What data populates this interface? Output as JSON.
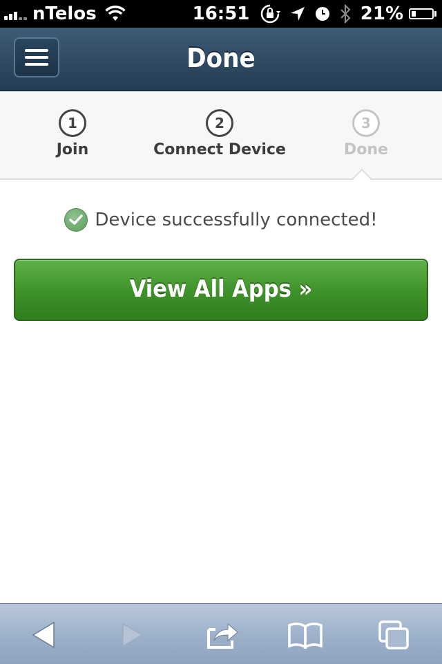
{
  "status_bar": {
    "carrier": "nTelos",
    "time": "16:51",
    "battery_percent": "21%",
    "battery_level": 0.21
  },
  "header": {
    "title": "Done",
    "menu_icon": "hamburger-menu-icon"
  },
  "steps": [
    {
      "number": "1",
      "label": "Join",
      "state": "complete"
    },
    {
      "number": "2",
      "label": "Connect Device",
      "state": "complete"
    },
    {
      "number": "3",
      "label": "Done",
      "state": "current"
    }
  ],
  "content": {
    "status_message": "Device successfully connected!",
    "view_apps_button": "View All Apps »"
  },
  "toolbar": {
    "icons": [
      "back-arrow-icon",
      "forward-arrow-icon",
      "share-icon",
      "bookmarks-icon",
      "tabs-icon"
    ]
  },
  "colors": {
    "header": "#2e4861",
    "success_green": "#3e9129",
    "step_inactive": "#c4c4c4",
    "toolbar": "#9fb2cb"
  }
}
